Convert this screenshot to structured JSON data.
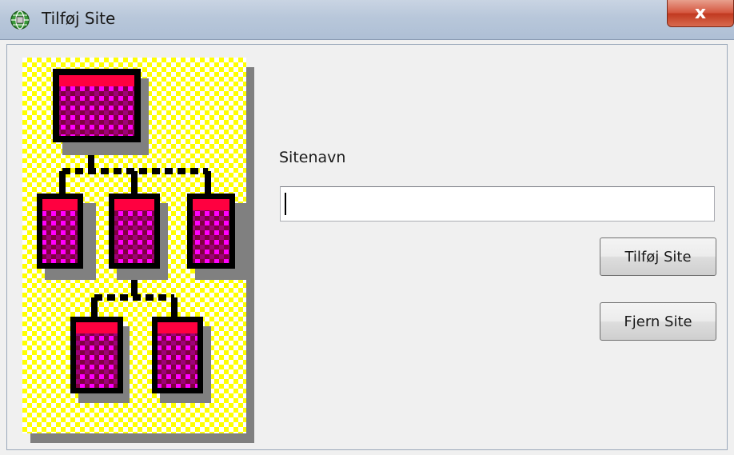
{
  "window": {
    "title": "Tilføj Site",
    "close_label": "x"
  },
  "form": {
    "site_name_label": "Sitenavn",
    "site_name_value": "",
    "add_button_label": "Tilføj Site",
    "remove_button_label": "Fjern Site"
  },
  "icons": {
    "app_icon": "globe-network-icon",
    "illustration": "network-hierarchy-illustration"
  },
  "colors": {
    "checker_yellow": "#ffff00",
    "checker_white": "#ffffff",
    "node_magenta": "#ff00ff",
    "node_dark": "#800040",
    "node_red": "#ff0040",
    "close_red": "#c0381f"
  }
}
